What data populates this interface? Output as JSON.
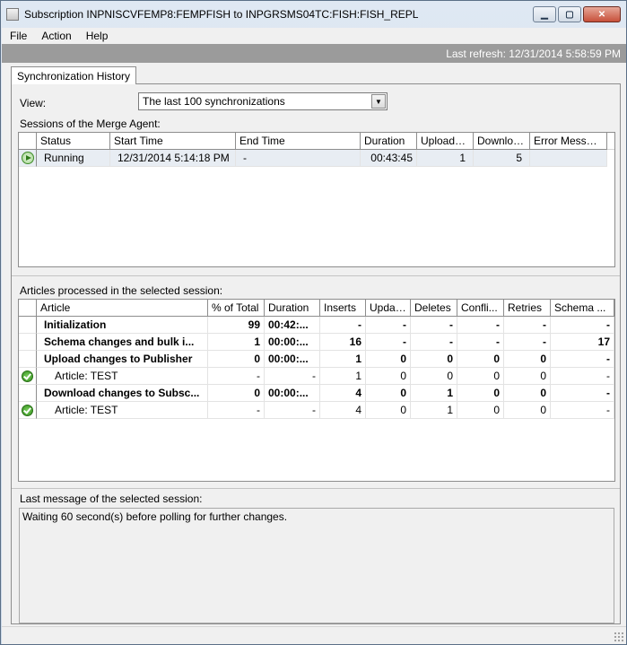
{
  "window": {
    "title": "Subscription INPNISCVFEMP8:FEMPFISH to INPGRSMS04TC:FISH:FISH_REPL",
    "controls": {
      "minimize": "▁",
      "maximize": "▢",
      "close": "✕"
    }
  },
  "menu": [
    "File",
    "Action",
    "Help"
  ],
  "refresh": {
    "text": "Last refresh: 12/31/2014 5:58:59 PM"
  },
  "tab": {
    "label": "Synchronization History"
  },
  "view": {
    "label": "View:",
    "selected": "The last 100 synchronizations",
    "arrow": "▼"
  },
  "sessions": {
    "label": "Sessions of the Merge Agent:",
    "columns": [
      "Status",
      "Start Time",
      "End Time",
      "Duration",
      "Uploade...",
      "Downloa...",
      "Error Message"
    ],
    "rows": [
      {
        "icon": "play-icon",
        "status": "Running",
        "start_time": "12/31/2014 5:14:18 PM",
        "end_time": "-",
        "duration": "00:43:45",
        "uploaded": "1",
        "downloaded": "5",
        "error": ""
      }
    ]
  },
  "articles": {
    "label": "Articles processed in the selected session:",
    "columns": [
      "Article",
      "% of Total",
      "Duration",
      "Inserts",
      "Updat...",
      "Deletes",
      "Confli...",
      "Retries",
      "Schema ..."
    ],
    "rows": [
      {
        "icon": "",
        "bold": true,
        "article": "Initialization",
        "pct": "99",
        "duration": "00:42:...",
        "inserts": "-",
        "updates": "-",
        "deletes": "-",
        "conflicts": "-",
        "retries": "-",
        "schema": "-"
      },
      {
        "icon": "",
        "bold": true,
        "article": "Schema changes and bulk i...",
        "pct": "1",
        "duration": "00:00:...",
        "inserts": "16",
        "updates": "-",
        "deletes": "-",
        "conflicts": "-",
        "retries": "-",
        "schema": "17"
      },
      {
        "icon": "",
        "bold": true,
        "article": "Upload changes to Publisher",
        "pct": "0",
        "duration": "00:00:...",
        "inserts": "1",
        "updates": "0",
        "deletes": "0",
        "conflicts": "0",
        "retries": "0",
        "schema": "-"
      },
      {
        "icon": "check-icon",
        "bold": false,
        "article": "Article: TEST",
        "pct": "-",
        "duration": "-",
        "inserts": "1",
        "updates": "0",
        "deletes": "0",
        "conflicts": "0",
        "retries": "0",
        "schema": "-"
      },
      {
        "icon": "",
        "bold": true,
        "article": "Download changes to Subsc...",
        "pct": "0",
        "duration": "00:00:...",
        "inserts": "4",
        "updates": "0",
        "deletes": "1",
        "conflicts": "0",
        "retries": "0",
        "schema": "-"
      },
      {
        "icon": "check-icon",
        "bold": false,
        "article": "Article: TEST",
        "pct": "-",
        "duration": "-",
        "inserts": "4",
        "updates": "0",
        "deletes": "1",
        "conflicts": "0",
        "retries": "0",
        "schema": "-"
      }
    ]
  },
  "last_message": {
    "label": "Last message of the selected session:",
    "text": "Waiting 60 second(s) before polling for further changes."
  }
}
